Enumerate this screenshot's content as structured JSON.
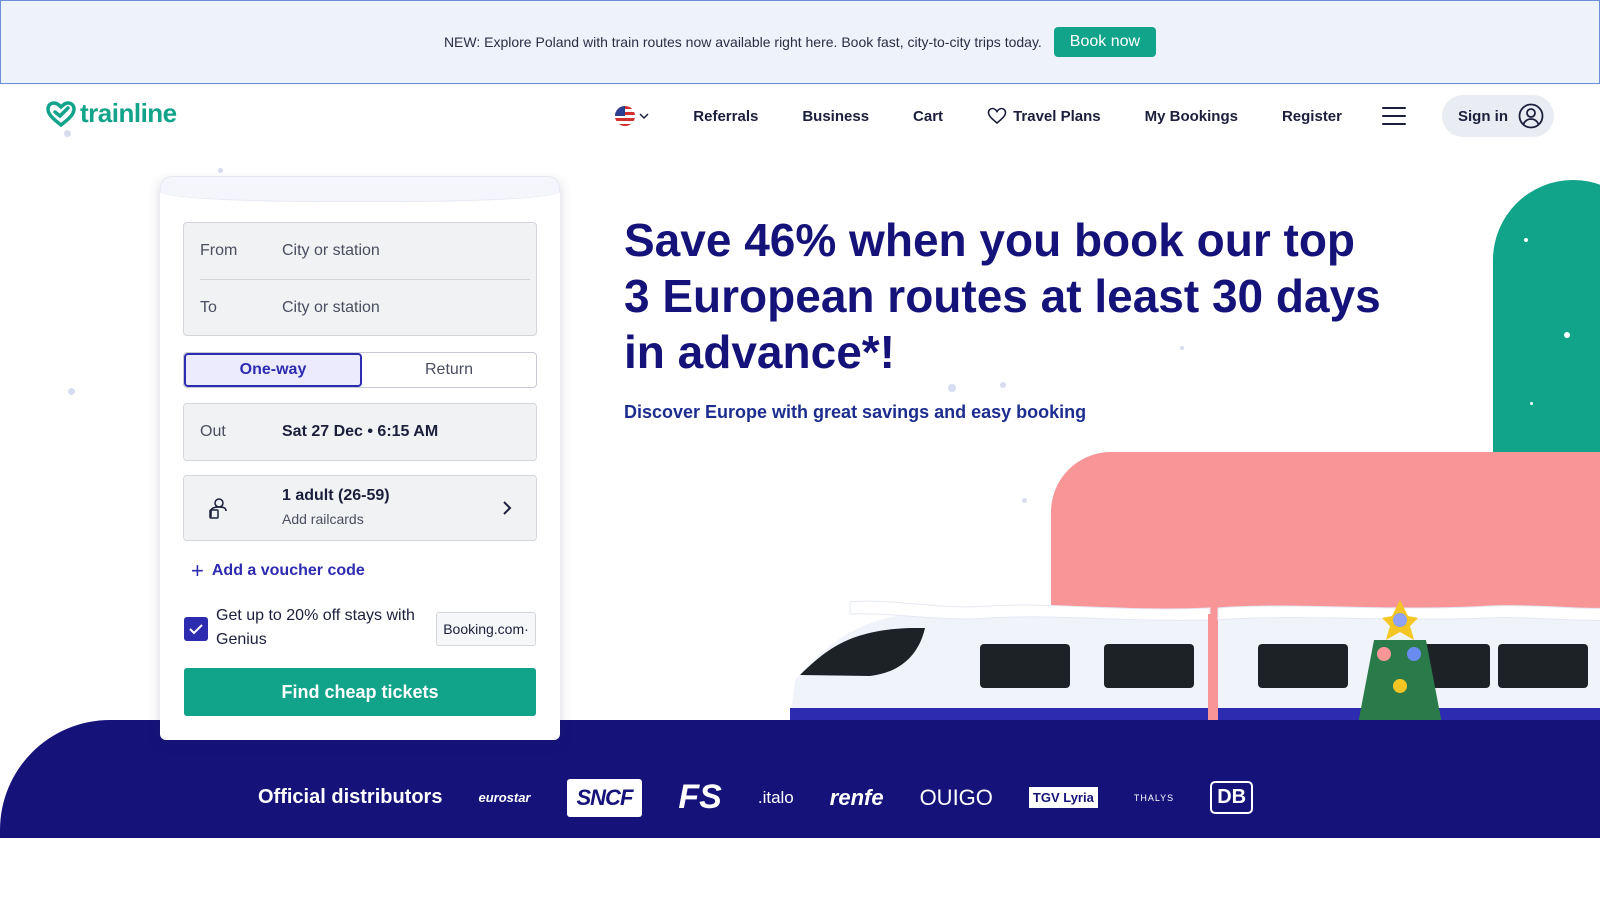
{
  "promo": {
    "text": "NEW: Explore Poland with train routes now available right here. Book fast, city-to-city trips today.",
    "button_label": "Book now"
  },
  "header": {
    "brand": "trainline",
    "language_icon": "us-flag-icon",
    "nav": [
      {
        "label": "Referrals"
      },
      {
        "label": "Business"
      },
      {
        "label": "Cart"
      },
      {
        "label": "Travel Plans",
        "icon": "heart-icon"
      },
      {
        "label": "My Bookings"
      },
      {
        "label": "Register"
      }
    ],
    "menu_icon": "hamburger-icon",
    "signin_label": "Sign in",
    "signin_icon": "user-circle-icon"
  },
  "search": {
    "from_label": "From",
    "from_placeholder": "City or station",
    "to_label": "To",
    "to_placeholder": "City or station",
    "trip_types": [
      "One-way",
      "Return"
    ],
    "selected_trip_type": "One-way",
    "out_label": "Out",
    "out_value": "Sat 27 Dec • 6:15 AM",
    "passengers": "1 adult (26-59)",
    "railcards": "Add railcards",
    "voucher_label": "Add a voucher code",
    "genius_text": "Get up to 20% off stays with Genius",
    "genius_checked": true,
    "booking_badge": "Booking.com·",
    "submit_label": "Find cheap tickets"
  },
  "hero": {
    "title": "Save 46% when you book our top 3 European routes at least 30 days in advance*!",
    "subtitle": "Discover Europe with great savings and easy booking"
  },
  "distributors": {
    "title": "Official distributors",
    "logos": [
      "eurostar",
      "SNCF",
      "FS",
      ".italo",
      "renfe",
      "OUIGO",
      "TGV Lyria",
      "THALYS",
      "DB"
    ]
  },
  "colors": {
    "brand_green": "#12a38b",
    "navy": "#15137a",
    "accent_blue": "#2d2bb0",
    "pink": "#f79597"
  }
}
